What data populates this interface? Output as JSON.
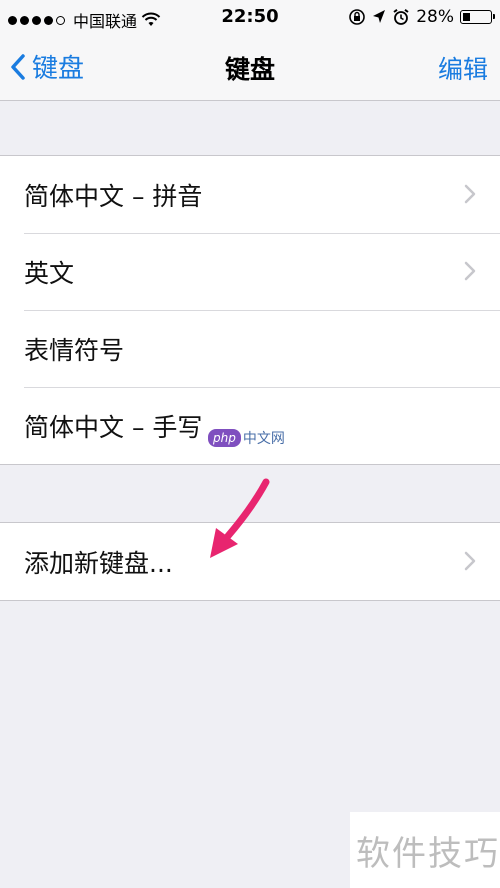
{
  "status_bar": {
    "carrier": "中国联通",
    "time": "22:50",
    "battery": "28%",
    "battery_level": 0.28,
    "signal_dots_filled": 4,
    "signal_dots_total": 5
  },
  "nav": {
    "back_label": "键盘",
    "title": "键盘",
    "edit_label": "编辑"
  },
  "keyboards": [
    {
      "label": "简体中文 – 拼音",
      "chevron": true
    },
    {
      "label": "英文",
      "chevron": true
    },
    {
      "label": "表情符号",
      "chevron": false
    },
    {
      "label": "简体中文 – 手写",
      "chevron": false
    }
  ],
  "add_keyboard": {
    "label": "添加新键盘..."
  },
  "watermarks": {
    "php_badge": "php",
    "php_site": "中文网",
    "corner_text": "软件技巧"
  },
  "colors": {
    "accent": "#1a7ce0",
    "background": "#efeff4",
    "arrow": "#e8256f"
  },
  "icons": [
    "wifi-icon",
    "orientation-lock-icon",
    "location-icon",
    "alarm-icon",
    "battery-icon",
    "back-chevron-icon",
    "chevron-right-icon"
  ]
}
